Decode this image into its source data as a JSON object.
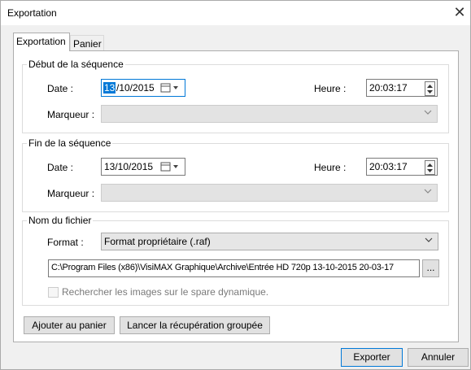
{
  "window": {
    "title": "Exportation",
    "close_symbol": "✕"
  },
  "tabs": [
    {
      "label": "Exportation"
    },
    {
      "label": "Panier"
    }
  ],
  "start": {
    "legend": "Début de la séquence",
    "date_label": "Date :",
    "date_day": "13",
    "date_rest": "/10/2015",
    "time_label": "Heure :",
    "time_value": "20:03:17",
    "marker_label": "Marqueur :"
  },
  "end": {
    "legend": "Fin de la séquence",
    "date_label": "Date :",
    "date_value": "13/10/2015",
    "time_label": "Heure :",
    "time_value": "20:03:17",
    "marker_label": "Marqueur :"
  },
  "file": {
    "legend": "Nom du fichier",
    "format_label": "Format :",
    "format_value": "Format propriétaire (.raf)",
    "path_value": "C:\\Program Files (x86)\\VisiMAX Graphique\\Archive\\Entrée HD 720p 13-10-2015 20-03-17",
    "browse_label": "...",
    "checkbox_label": "Rechercher les images sur le spare dynamique.",
    "checkbox_checked": false
  },
  "actions": {
    "add_label": "Ajouter au panier",
    "batch_label": "Lancer la récupération groupée"
  },
  "footer": {
    "export_label": "Exporter",
    "cancel_label": "Annuler"
  },
  "colors": {
    "accent": "#0078d7",
    "selection": "#0078d7"
  }
}
